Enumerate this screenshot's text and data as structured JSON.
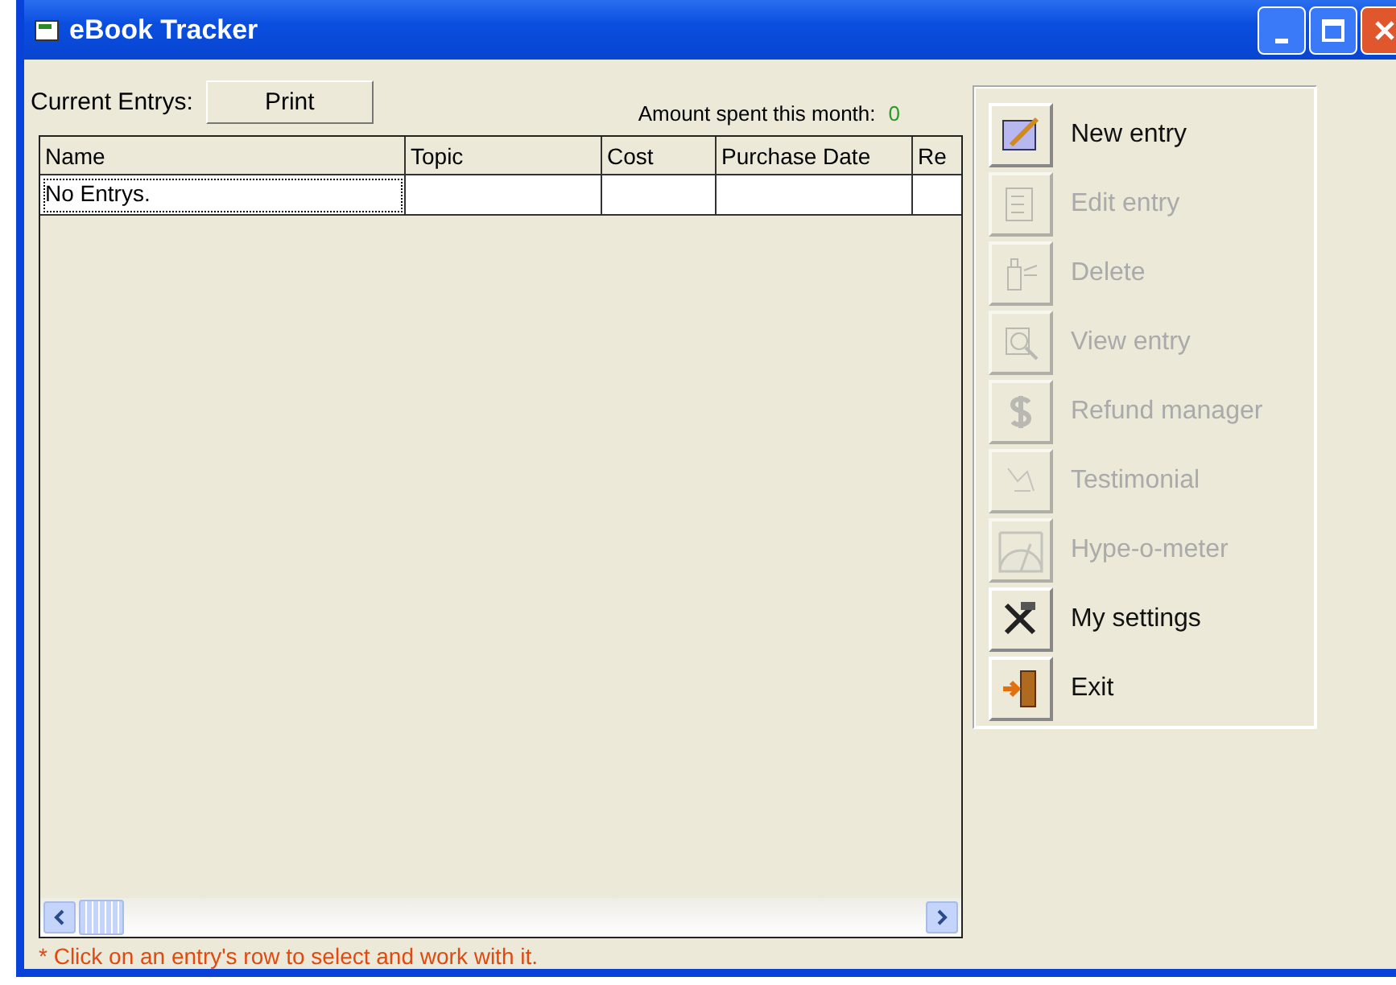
{
  "window": {
    "title": "eBook Tracker"
  },
  "header": {
    "label": "Current Entrys:",
    "print_button": "Print",
    "amount_label": "Amount spent this month:",
    "amount_value": "0"
  },
  "table": {
    "columns": [
      "Name",
      "Topic",
      "Cost",
      "Purchase Date",
      "Re"
    ],
    "rows": [
      {
        "cells": [
          "No Entrys.",
          "",
          "",
          "",
          ""
        ],
        "focused": true
      }
    ]
  },
  "actions": [
    {
      "label": "New entry",
      "disabled": false
    },
    {
      "label": "Edit entry",
      "disabled": true
    },
    {
      "label": "Delete",
      "disabled": true
    },
    {
      "label": "View entry",
      "disabled": true
    },
    {
      "label": "Refund manager",
      "disabled": true
    },
    {
      "label": "Testimonial",
      "disabled": true
    },
    {
      "label": "Hype-o-meter",
      "disabled": true
    },
    {
      "label": "My settings",
      "disabled": false
    },
    {
      "label": "Exit",
      "disabled": false
    }
  ],
  "hint": "* Click on an entry's row to select and work with it."
}
